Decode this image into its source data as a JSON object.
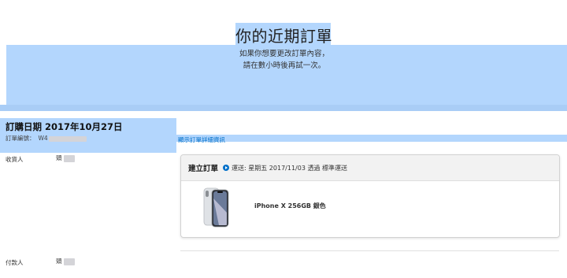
{
  "header": {
    "title": "你的近期訂單",
    "notice_line1": "如果你想要更改訂單內容，",
    "notice_line2": "請在數小時後再試一次。"
  },
  "order": {
    "date_label": "訂購日期 2017年10月27日",
    "number_label": "訂單編號：",
    "number_value": "W4",
    "details_link": "顯示訂單詳細資訊"
  },
  "recipient": {
    "label": "收貨人",
    "name": "頭"
  },
  "payer": {
    "label": "付款人",
    "name": "頭"
  },
  "shipment": {
    "title": "建立訂單",
    "status_icon": "play-circle-icon",
    "status_text": "運送: 星期五 2017/11/03 透過 標準運送",
    "product_name": "iPhone X 256GB 銀色",
    "product_image": "iphone-x-silver"
  },
  "colors": {
    "selection_highlight": "#b3d6fd",
    "link": "#0070c9",
    "card_header_bg": "#f2f2f2"
  }
}
